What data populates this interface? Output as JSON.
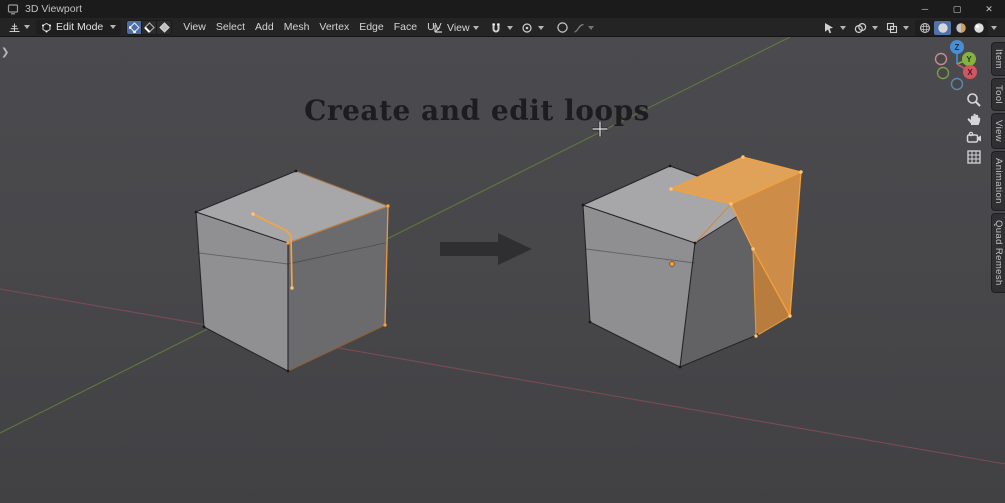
{
  "window": {
    "title": "3D Viewport",
    "controls": {
      "minimize": "─",
      "maximize": "▢",
      "close": "✕"
    }
  },
  "header": {
    "mode_label": "Edit Mode",
    "menus": [
      {
        "label": "View"
      },
      {
        "label": "Select"
      },
      {
        "label": "Add"
      },
      {
        "label": "Mesh"
      },
      {
        "label": "Vertex"
      },
      {
        "label": "Edge"
      },
      {
        "label": "Face"
      },
      {
        "label": "UV"
      }
    ],
    "orientation_label": "View"
  },
  "viewport": {
    "caption": "Create and edit loops",
    "sidebar_tabs": [
      {
        "label": "Item"
      },
      {
        "label": "Tool"
      },
      {
        "label": "View"
      },
      {
        "label": "Animation"
      },
      {
        "label": "Quad Remesh"
      }
    ],
    "gizmo": {
      "x": "X",
      "y": "Y",
      "z": "Z"
    }
  },
  "colors": {
    "selection_orange": "#f7a440",
    "accent_blue": "#4b6ea9",
    "axis_x": "#d45561",
    "axis_y": "#86b340",
    "axis_z": "#468fd4"
  }
}
